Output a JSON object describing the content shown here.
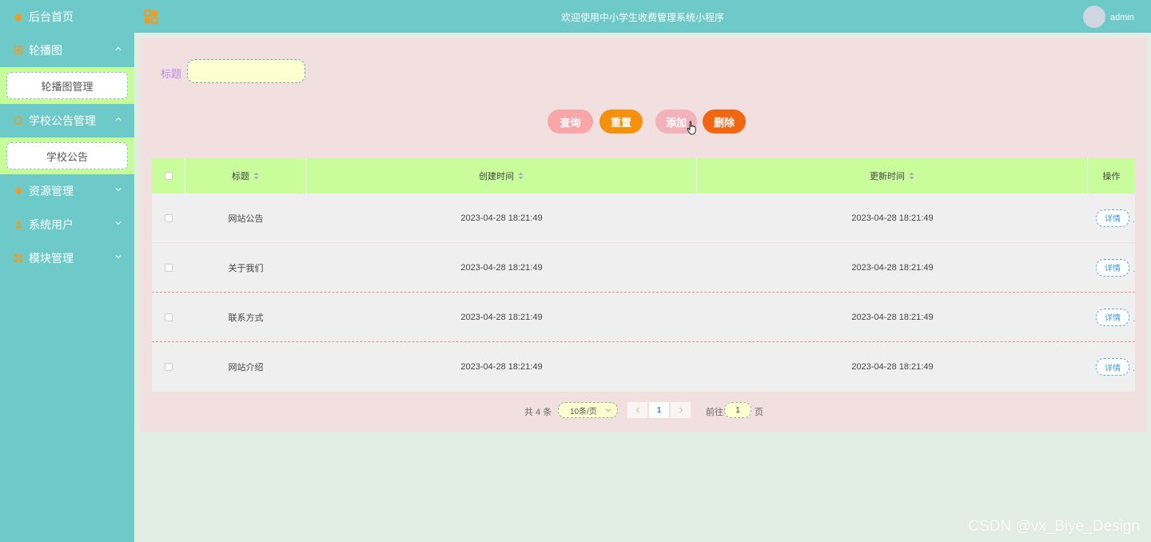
{
  "header": {
    "title": "欢迎使用中小学生收费管理系统小程序",
    "username": "admin"
  },
  "sidebar": {
    "home_label": "后台首页",
    "groups": [
      {
        "label": "轮播图",
        "sub": "轮播图管理"
      },
      {
        "label": "学校公告管理",
        "sub": "学校公告"
      },
      {
        "label": "资源管理"
      },
      {
        "label": "系统用户"
      },
      {
        "label": "模块管理"
      }
    ]
  },
  "search": {
    "label": "标题",
    "value": "",
    "placeholder": ""
  },
  "buttons": {
    "query": "查询",
    "reset": "重置",
    "add": "添加",
    "delete": "删除"
  },
  "table": {
    "columns": [
      "标题",
      "创建时间",
      "更新时间",
      "操作"
    ],
    "rows": [
      {
        "title": "网站公告",
        "created": "2023-04-28 18:21:49",
        "updated": "2023-04-28 18:21:49",
        "action": "详情"
      },
      {
        "title": "关于我们",
        "created": "2023-04-28 18:21:49",
        "updated": "2023-04-28 18:21:49",
        "action": "详情"
      },
      {
        "title": "联系方式",
        "created": "2023-04-28 18:21:49",
        "updated": "2023-04-28 18:21:49",
        "action": "详情"
      },
      {
        "title": "网站介绍",
        "created": "2023-04-28 18:21:49",
        "updated": "2023-04-28 18:21:49",
        "action": "详情"
      }
    ]
  },
  "pagination": {
    "total": "共 4 条",
    "page_size": "10条/页",
    "current_page": "1",
    "goto_label": "前往",
    "goto_value": "1",
    "page_suffix": "页"
  },
  "watermark": "CSDN @vx_Biye_Design",
  "colors": {
    "sidebar": "#6ecac9",
    "header": "#6ecac9",
    "submenu": "#c6fd9b",
    "table_header": "#c9fd9b",
    "main_panel": "#f2e0e0",
    "query_btn": "#f8a6a8",
    "reset_btn": "#f3910c",
    "add_btn": "#f2b2bb",
    "delete_btn": "#f06613"
  }
}
